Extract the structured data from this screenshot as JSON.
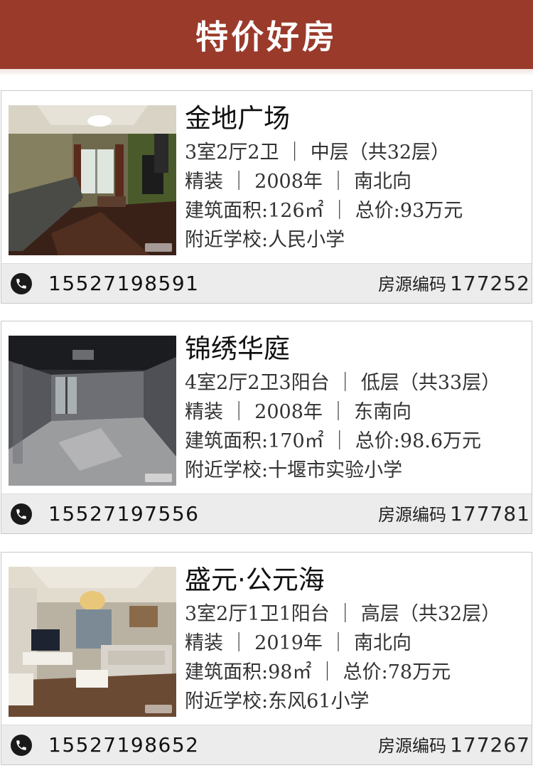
{
  "header": {
    "title": "特价好房"
  },
  "listings": [
    {
      "name": "金地广场",
      "layout_floor": "3室2厅2卫 ｜ 中层（共32层）",
      "decor_year_orient": "精装 ｜ 2008年 ｜ 南北向",
      "area_price": "建筑面积:126㎡ ｜ 总价:93万元",
      "school": "附近学校:人民小学",
      "phone": "15527198591",
      "code_label": "房源编码",
      "code": "177252",
      "photo_icon": "living-room-photo"
    },
    {
      "name": "锦绣华庭",
      "layout_floor": "4室2厅2卫3阳台 ｜ 低层（共33层）",
      "decor_year_orient": "精装 ｜ 2008年 ｜ 东南向",
      "area_price": "建筑面积:170㎡ ｜ 总价:98.6万元",
      "school": "附近学校:十堰市实验小学",
      "phone": "15527197556",
      "code_label": "房源编码",
      "code": "177781",
      "photo_icon": "empty-room-photo"
    },
    {
      "name": "盛元·公元海",
      "layout_floor": "3室2厅1卫1阳台 ｜ 高层（共32层）",
      "decor_year_orient": "精装 ｜ 2019年 ｜ 南北向",
      "area_price": "建筑面积:98㎡ ｜ 总价:78万元",
      "school": "附近学校:东风61小学",
      "phone": "15527198652",
      "code_label": "房源编码",
      "code": "177267",
      "photo_icon": "furnished-living-room-photo"
    }
  ],
  "colors": {
    "header": "#9a3a2b",
    "footer": "#ececec",
    "phone_icon": "#1a1a1a"
  }
}
